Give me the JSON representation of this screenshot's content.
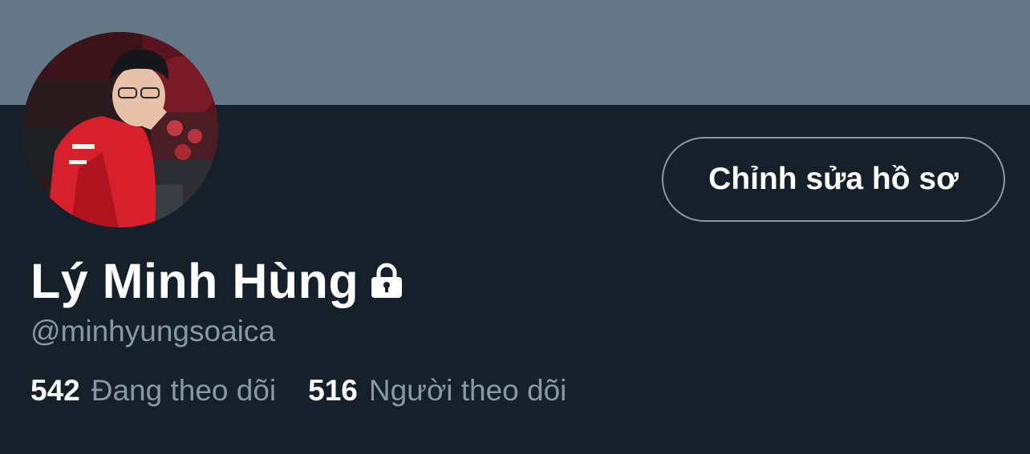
{
  "profile": {
    "display_name": "Lý Minh Hùng",
    "handle": "@minhyungsoaica",
    "edit_button_label": "Chỉnh sửa hồ sơ",
    "protected_icon": "lock-icon"
  },
  "stats": {
    "following_count": "542",
    "following_label": "Đang theo dõi",
    "followers_count": "516",
    "followers_label": "Người theo dõi"
  },
  "colors": {
    "background": "#15202b",
    "banner": "#657786",
    "secondary_text": "#8899a6",
    "primary_text": "#ffffff",
    "button_border": "#8899a6"
  }
}
